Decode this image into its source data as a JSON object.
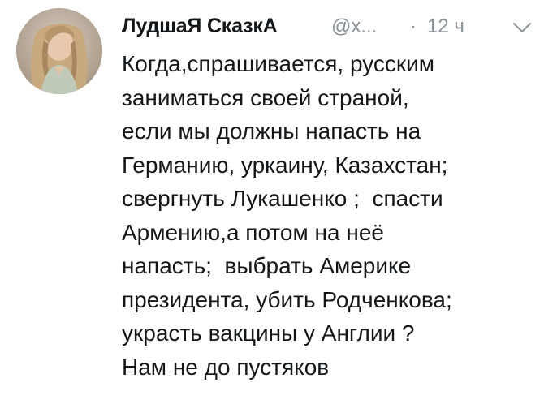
{
  "tweet": {
    "author": {
      "display_name": "ЛудшаЯ СказкА",
      "handle": "@х...",
      "avatar_icon": "user-photo-avatar"
    },
    "separator": "·",
    "time": "12 ч",
    "menu_icon": "chevron-down-icon",
    "text_lines": [
      "Когда,спрашивается, русским",
      "заниматься своей страной,",
      "если мы должны напасть на",
      "Германию, уркаину, Казахстан;",
      "свергнуть Лукашенко ;  спасти",
      "Армению,а потом на неё",
      "напасть;  выбрать Америке",
      "президента, убить Родченкова;",
      "украсть вакцины у Англии ?",
      "Нам не до пустяков"
    ]
  },
  "colors": {
    "text_primary": "#14171a",
    "text_secondary": "#8a9199",
    "background": "#ffffff"
  }
}
